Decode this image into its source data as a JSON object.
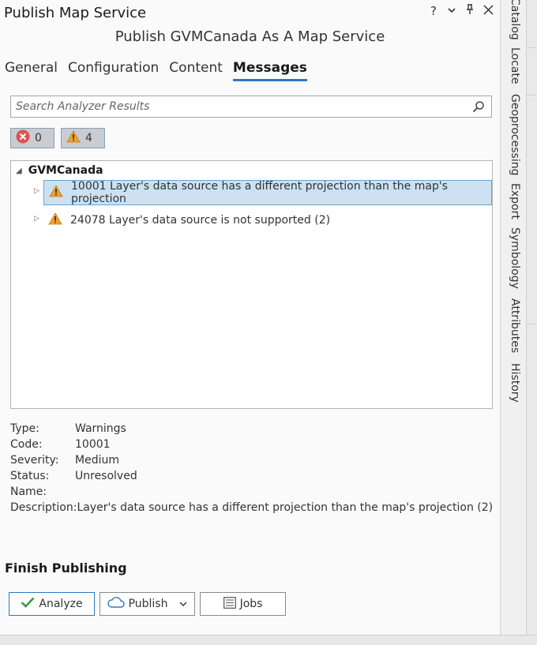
{
  "window": {
    "title": "Publish Map Service",
    "subtitle": "Publish GVMCanada As A Map Service",
    "ctrl_help": "?"
  },
  "tabs": [
    {
      "label": "General"
    },
    {
      "label": "Configuration"
    },
    {
      "label": "Content"
    },
    {
      "label": "Messages",
      "active": true
    }
  ],
  "search": {
    "placeholder": "Search Analyzer Results",
    "value": ""
  },
  "filters": {
    "errors": "0",
    "warnings": "4"
  },
  "tree": {
    "root": "GVMCanada",
    "items": [
      {
        "text": "10001 Layer's data source has a different projection than the map's projection",
        "selected": true
      },
      {
        "text": "24078 Layer's data source is not supported (2)",
        "selected": false
      }
    ]
  },
  "details": {
    "type_label": "Type:",
    "type": "Warnings",
    "code_label": "Code:",
    "code": "10001",
    "severity_label": "Severity:",
    "severity": "Medium",
    "status_label": "Status:",
    "status": "Unresolved",
    "name_label": "Name:",
    "name": "",
    "description_label": "Description:",
    "description": "Layer's data source has a different projection than the map's projection (2)"
  },
  "finish": {
    "heading": "Finish Publishing",
    "analyze": "Analyze",
    "publish": "Publish",
    "jobs": "Jobs"
  },
  "side_tabs": [
    "Catalog",
    "Locate",
    "Geoprocessing",
    "Export",
    "Symbology",
    "Attributes",
    "History"
  ],
  "colors": {
    "accent": "#2b79c5",
    "warning": "#f0a030",
    "error": "#d9534f",
    "selection": "#cbe1f2"
  }
}
